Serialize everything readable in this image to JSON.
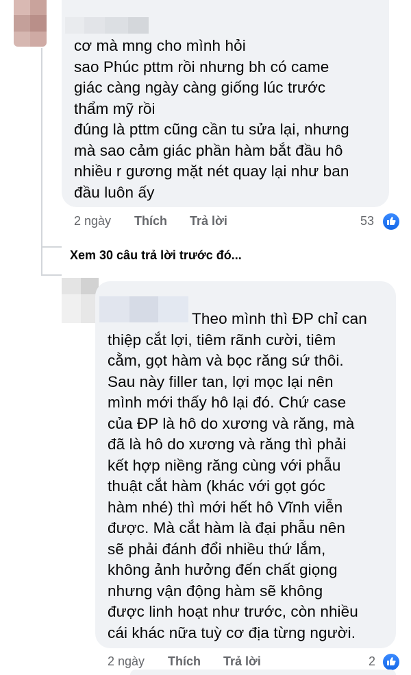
{
  "comments": [
    {
      "text": "cơ mà mng cho mình hỏi\nsao Phúc pttm rồi nhưng bh có came\ngiác càng ngày càng giống lúc trước\nthẩm mỹ rồi\nđúng là pttm cũng cần tu sửa lại, nhưng\nmà sao cảm giác phần hàm bắt đầu hô\nnhiều r gương mặt nét quay lại như ban\nđầu luôn ấy",
      "time": "2 ngày",
      "like_label": "Thích",
      "reply_label": "Trả lời",
      "reaction_count": "53"
    },
    {
      "text": "Theo mình thì ĐP chỉ can\nthiệp cắt lợi, tiêm rãnh cười, tiêm\ncằm, gọt hàm và bọc răng sứ thôi.\nSau này filler tan, lợi mọc lại nên\nmình mới thấy hô lại đó. Chứ case\ncủa ĐP là hô do xương và răng, mà\nđã là hô do xương và răng thì phải\nkết hợp niềng răng cùng với phẫu\nthuật cắt hàm (khác với gọt góc\nhàm nhé) thì mới hết hô Vĩnh viễn\nđược. Mà cắt hàm là đại phẫu nên\nsẽ phải đánh đổi nhiều thứ lắm,\nkhông ảnh hưởng đến chất giọng\nnhưng vận động hàm sẽ không\nđược linh hoạt như trước, còn nhiều\ncái khác nữa tuỳ cơ địa từng người.",
      "time": "2 ngày",
      "like_label": "Thích",
      "reply_label": "Trả lời",
      "reaction_count": "2"
    }
  ],
  "view_previous_replies": "Xem 30 câu trả lời trước đó...",
  "colors": {
    "bubble": "#f0f2f5",
    "meta_text": "#65676b",
    "like_blue": "#1877f2",
    "thread_line": "#d3d6da"
  },
  "icons": [
    "thumbs-up-icon"
  ]
}
